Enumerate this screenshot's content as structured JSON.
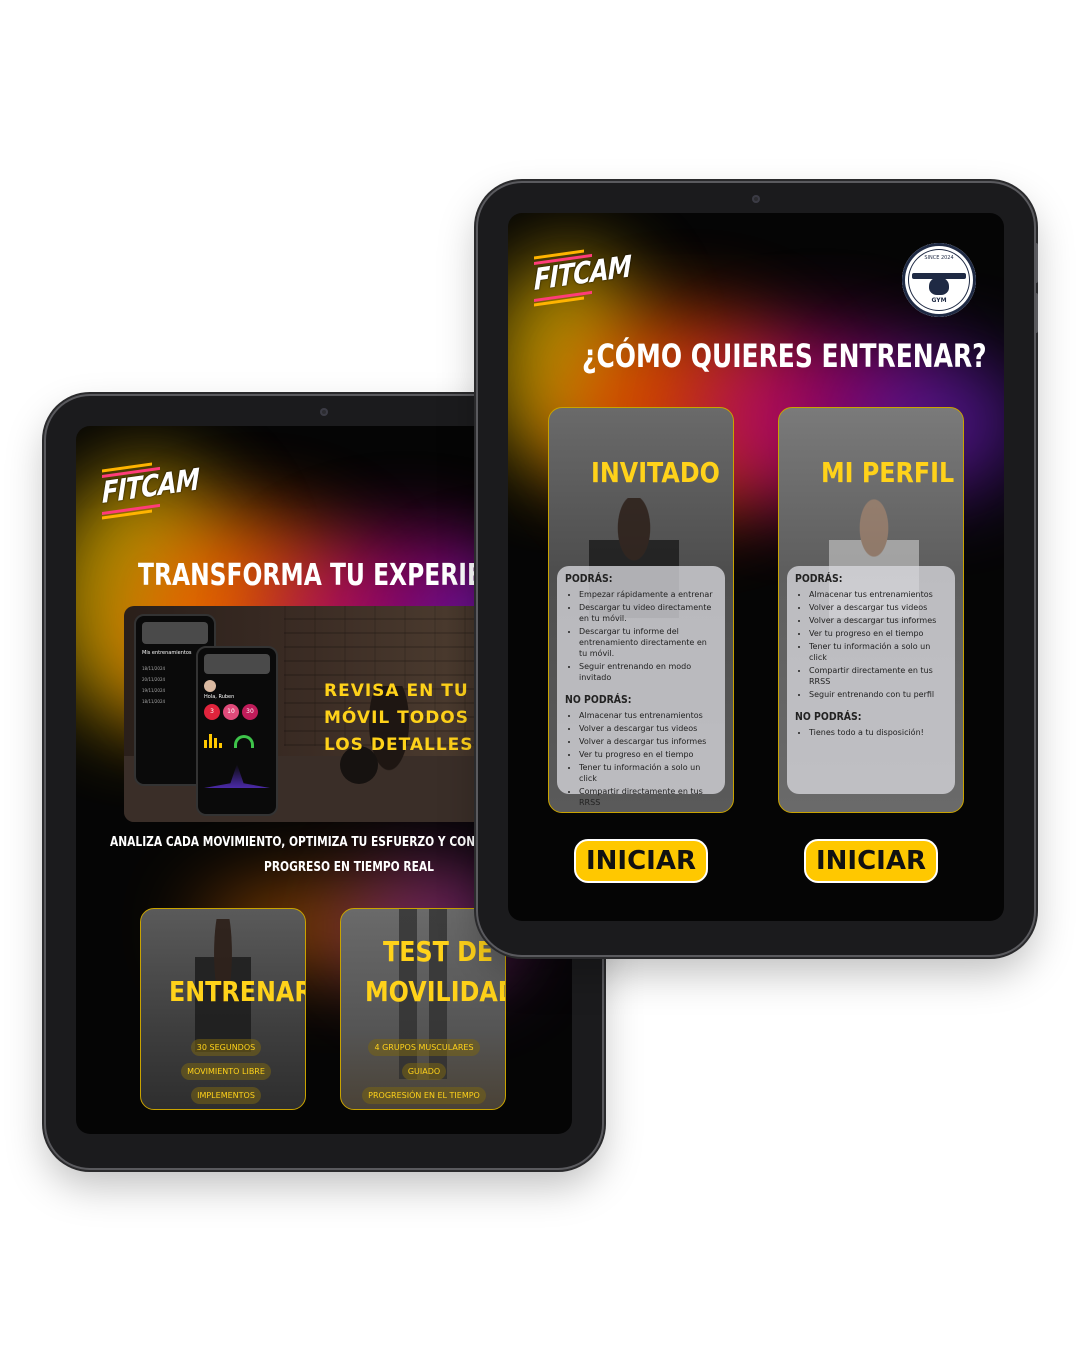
{
  "brand": {
    "logo_text": "FITCAM"
  },
  "left_screen": {
    "headline": "TRANSFORMA TU EXPERIENCIA",
    "promo_text": "REVISA EN TU MÓVIL TODOS LOS DETALLES",
    "subtitle_line1": "ANALIZA CADA MOVIMIENTO, OPTIMIZA TU ESFUERZO Y CONTROLA TU",
    "subtitle_line2": "PROGRESO EN TIEMPO REAL",
    "phone_small": {
      "title": "Mis entrenamientos",
      "dates": [
        "18/11/2024",
        "20/11/2024",
        "19/11/2024",
        "18/11/2024"
      ]
    },
    "phone_large": {
      "greeting": "Hola, Ruben",
      "stats": [
        "3",
        "10",
        "30"
      ]
    },
    "cards": [
      {
        "title": "ENTRENAR",
        "chips": [
          "30 SEGUNDOS",
          "MOVIMIENTO LIBRE",
          "IMPLEMENTOS"
        ]
      },
      {
        "title_line1": "TEST DE",
        "title_line2": "MOVILIDAD",
        "chips": [
          "4 GRUPOS MUSCULARES",
          "GUIADO",
          "PROGRESIÓN EN EL TIEMPO"
        ]
      }
    ]
  },
  "right_screen": {
    "gym_badge": {
      "top": "SINCE 2024",
      "bottom": "GYM"
    },
    "question": "¿CÓMO QUIERES ENTRENAR?",
    "options": [
      {
        "title": "INVITADO",
        "can_label": "PODRÁS:",
        "can": [
          "Empezar rápidamente a entrenar",
          "Descargar tu video directamente en tu móvil.",
          "Descargar tu informe del entrenamiento directamente en tu móvil.",
          "Seguir entrenando en modo invitado"
        ],
        "cannot_label": "NO PODRÁS:",
        "cannot": [
          "Almacenar tus entrenamientos",
          "Volver a descargar tus videos",
          "Volver a descargar tus informes",
          "Ver tu progreso en el tiempo",
          "Tener tu información a solo un click",
          "Compartir directamente en tus RRSS"
        ],
        "button": "INICIAR"
      },
      {
        "title": "MI PERFIL",
        "can_label": "PODRÁS:",
        "can": [
          "Almacenar tus entrenamientos",
          "Volver a descargar tus videos",
          "Volver a descargar tus informes",
          "Ver tu progreso en el tiempo",
          "Tener tu información a solo un click",
          "Compartir directamente en tus RRSS",
          "Seguir entrenando con tu perfil"
        ],
        "cannot_label": "NO PODRÁS:",
        "cannot": [
          "Tienes todo a tu disposición!"
        ],
        "button": "INICIAR"
      }
    ]
  },
  "colors": {
    "accent_yellow": "#ffd21a",
    "button_yellow": "#ffc800",
    "glow_orange": "#ff8a00",
    "glow_magenta": "#b0007a",
    "glow_purple": "#5a1aa8"
  },
  "icons": [
    "fitcam-logo",
    "gym-badge-logo",
    "camera-dot"
  ]
}
